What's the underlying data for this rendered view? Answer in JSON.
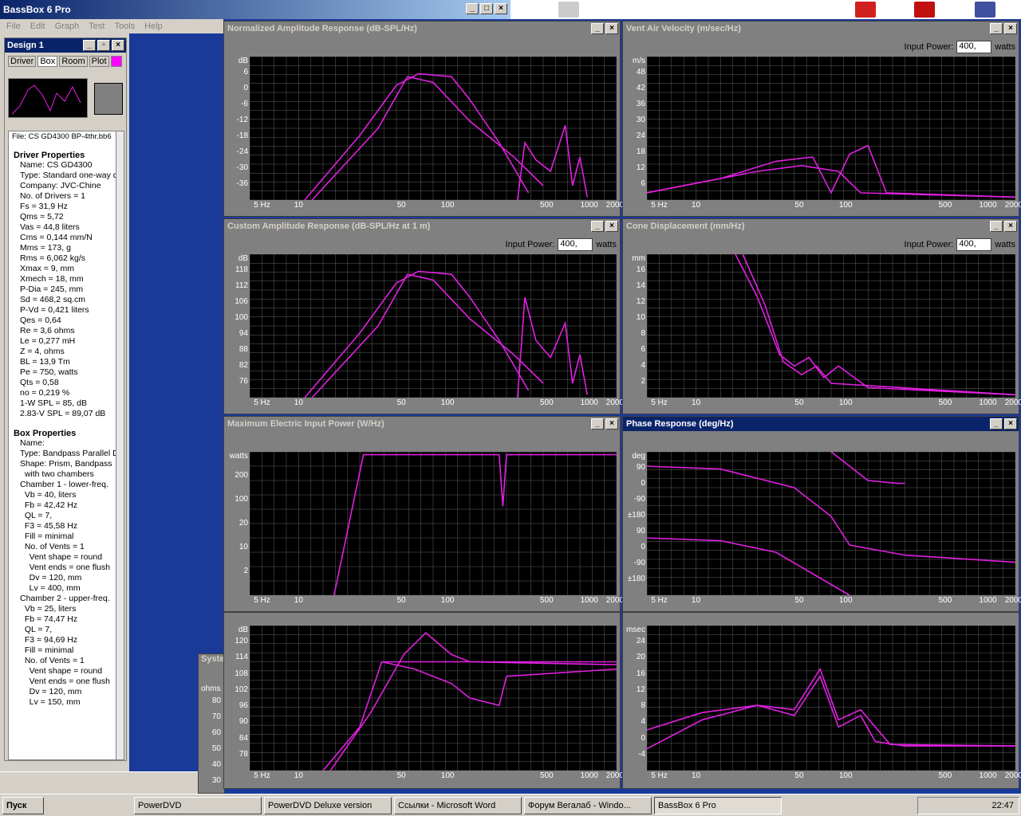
{
  "app": {
    "title": "BassBox 6 Pro",
    "menu": [
      "File",
      "Edit",
      "Graph",
      "Test",
      "Tools",
      "Help"
    ]
  },
  "design": {
    "title": "Design 1",
    "tabs": [
      "Driver",
      "Box",
      "Room",
      "Plot"
    ]
  },
  "props": {
    "file": "File: CS GD4300 BP-4thr.bb6",
    "driver_header": "Driver Properties",
    "driver": [
      "Name: CS GD4300",
      "Type: Standard one-way d",
      "Company: JVC-Chine",
      "No. of Drivers = 1",
      "Fs = 31,9 Hz",
      "Qms = 5,72",
      "Vas = 44,8 liters",
      "Cms = 0,144 mm/N",
      "Mms = 173, g",
      "Rms = 6,062 kg/s",
      "Xmax = 9, mm",
      "Xmech = 18, mm",
      "P-Dia = 245, mm",
      "Sd = 468,2 sq.cm",
      "P-Vd = 0,421 liters",
      "Qes = 0,64",
      "Re = 3,6 ohms",
      "Le = 0,277 mH",
      "Z = 4, ohms",
      "BL = 13,9 Tm",
      "Pe = 750, watts",
      "Qts = 0,58",
      "no = 0,219 %",
      "1-W SPL = 85, dB",
      "2.83-V SPL = 89,07 dB"
    ],
    "box_header": "Box Properties",
    "box": [
      "Name:",
      "Type: Bandpass Parallel D",
      "Shape: Prism, Bandpass",
      "  with two chambers",
      "Chamber 1 - lower-freq.",
      "  Vb = 40, liters",
      "  Fb = 42,42 Hz",
      "  QL = 7,",
      "  F3 = 45,58 Hz",
      "  Fill = minimal",
      "  No. of Vents = 1",
      "    Vent shape = round",
      "    Vent ends = one flush",
      "    Dv = 120, mm",
      "    Lv = 400, mm",
      "Chamber 2 - upper-freq.",
      "  Vb = 25, liters",
      "  Fb = 74,47 Hz",
      "  QL = 7,",
      "  F3 = 94,69 Hz",
      "  Fill = minimal",
      "  No. of Vents = 1",
      "    Vent shape = round",
      "    Vent ends = one flush",
      "    Dv = 120, mm",
      "    Lv = 150, mm"
    ]
  },
  "input_power": {
    "label": "Input Power:",
    "value": "400,",
    "unit": "watts"
  },
  "xticks": [
    "5 Hz",
    "10",
    "50",
    "100",
    "500",
    "1000",
    "2000"
  ],
  "panels": [
    {
      "id": "p1",
      "title": "Normalized Amplitude Response (dB-SPL/Hz)",
      "unit": "dB",
      "yticks": [
        "6",
        "0",
        "-6",
        "-12",
        "-18",
        "-24",
        "-30",
        "-36"
      ],
      "power": false
    },
    {
      "id": "p2",
      "title": "Vent Air Velocity (m/sec/Hz)",
      "unit": "m/s",
      "yticks": [
        "48",
        "42",
        "36",
        "30",
        "24",
        "18",
        "12",
        "6"
      ],
      "power": true
    },
    {
      "id": "p3",
      "title": "Custom Amplitude Response (dB-SPL/Hz at 1 m)",
      "unit": "dB",
      "yticks": [
        "118",
        "112",
        "106",
        "100",
        "94",
        "88",
        "82",
        "76"
      ],
      "power": true
    },
    {
      "id": "p4",
      "title": "Cone Displacement (mm/Hz)",
      "unit": "mm",
      "yticks": [
        "16",
        "14",
        "12",
        "10",
        "8",
        "6",
        "4",
        "2"
      ],
      "power": true
    },
    {
      "id": "p5",
      "title": "Maximum Electric Input Power (W/Hz)",
      "unit": "watts",
      "yticks": [
        "200",
        "100",
        "20",
        "10",
        "2"
      ],
      "power": false
    },
    {
      "id": "p6",
      "title": "Phase Response (deg/Hz)",
      "unit": "deg",
      "yticks": [
        "90",
        "0",
        "-90",
        "±180",
        "90",
        "0",
        "-90",
        "±180"
      ],
      "power": false
    },
    {
      "id": "p7",
      "title": "",
      "unit": "dB",
      "yticks": [
        "120",
        "114",
        "108",
        "102",
        "96",
        "90",
        "84",
        "78"
      ],
      "power": false
    },
    {
      "id": "p8",
      "title": "",
      "unit": "msec",
      "yticks": [
        "24",
        "20",
        "16",
        "12",
        "8",
        "4",
        "0",
        "-4"
      ],
      "power": false
    }
  ],
  "sys": {
    "title": "Syste",
    "unit": "ohms",
    "yticks": [
      "80",
      "70",
      "60",
      "50",
      "40",
      "30"
    ]
  },
  "taskbar": {
    "start": "Пуск",
    "items": [
      "PowerDVD",
      "PowerDVD Deluxe version",
      "Ссылки - Microsoft Word",
      "Форум Вегалаб - Windo...",
      "BassBox 6 Pro"
    ],
    "clock": "22:47"
  },
  "colors": {
    "curve": "#e020e0",
    "grid": "#606060",
    "plot_bg": "#000000"
  }
}
